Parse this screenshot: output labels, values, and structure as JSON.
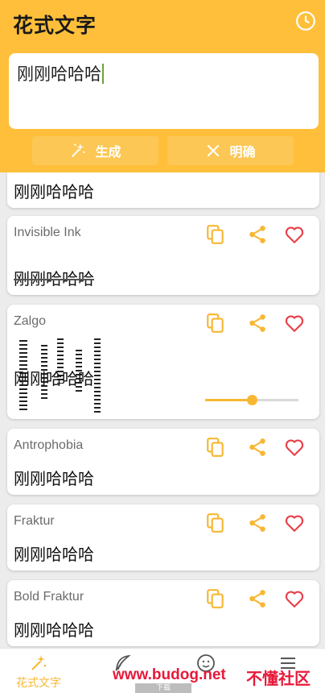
{
  "header": {
    "title": "花式文字",
    "history_icon": "clock-icon",
    "input_value": "刚刚哈哈哈",
    "generate_label": "生成",
    "clear_label": "明确",
    "accent": "#ffbf3a"
  },
  "cards": [
    {
      "name": "",
      "text": "刚刚哈哈哈"
    },
    {
      "name": "Invisible Ink",
      "text": "刚刚哈哈哈"
    },
    {
      "name": "Zalgo",
      "text": "刚刚哈哈哈",
      "slider_value": 0.5
    },
    {
      "name": "Antrophobia",
      "text": "刚刚哈哈哈"
    },
    {
      "name": "Fraktur",
      "text": "刚刚哈哈哈"
    },
    {
      "name": "Bold Fraktur",
      "text": "刚刚哈哈哈"
    }
  ],
  "nav": {
    "items": [
      {
        "label": "花式文字",
        "icon": "magic-wand-icon"
      },
      {
        "label": "",
        "icon": "feather-icon"
      },
      {
        "label": "",
        "icon": "smiley-icon"
      },
      {
        "label": "",
        "icon": "menu-icon"
      }
    ]
  },
  "watermark": {
    "site": "www.budog.net",
    "brand": "不懂社区",
    "tag": "下载"
  },
  "colors": {
    "accent": "#f7b733",
    "heart": "#e8414a",
    "watermark": "#e8193a"
  }
}
